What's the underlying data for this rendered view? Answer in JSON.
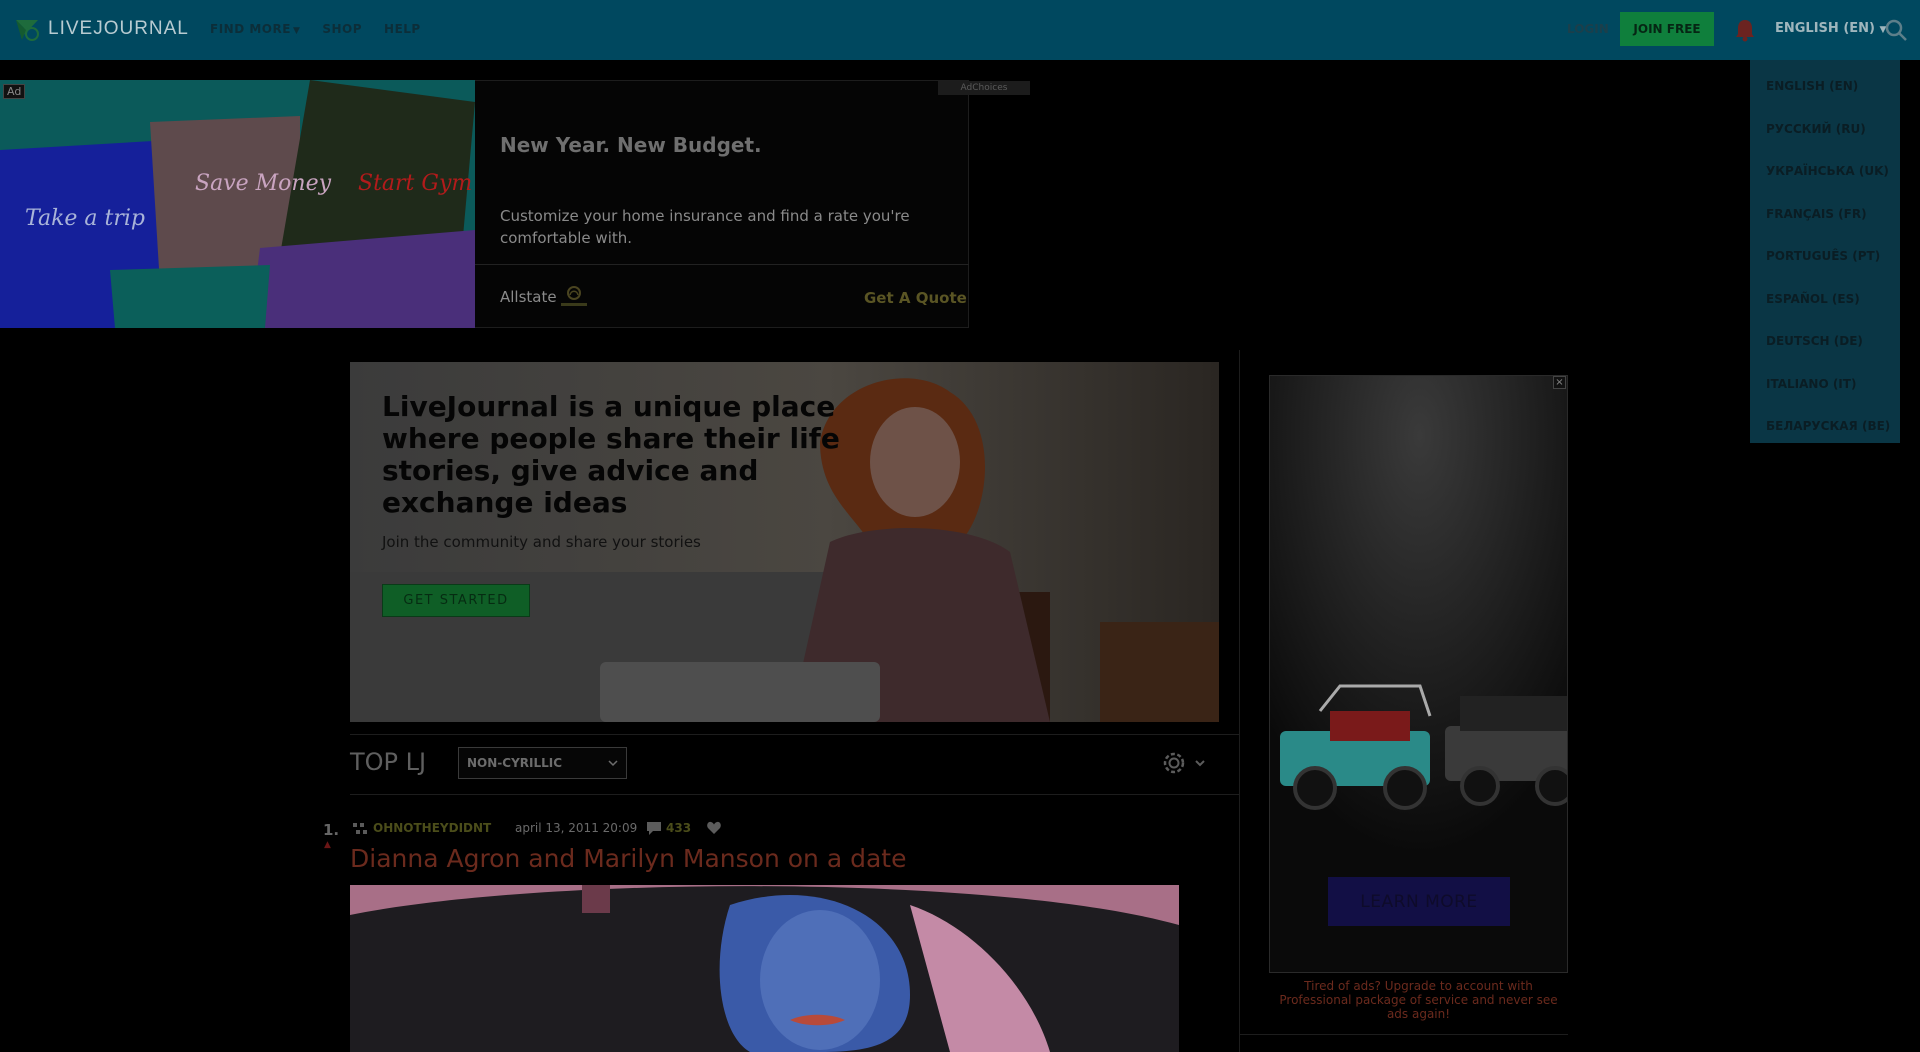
{
  "header": {
    "logo_text": "LIVEJOURNAL",
    "nav": [
      "FIND MORE",
      "SHOP",
      "HELP"
    ],
    "login": "LOGIN",
    "join": "JOIN FREE",
    "language": "ENGLISH (EN)"
  },
  "languages": [
    "ENGLISH (EN)",
    "РУССКИЙ (RU)",
    "УКРАЇНСЬКА (UK)",
    "FRANÇAIS (FR)",
    "PORTUGUÊS (PT)",
    "ESPAÑOL (ES)",
    "DEUTSCH (DE)",
    "ITALIANO (IT)",
    "БЕЛАРУСКАЯ (BE)"
  ],
  "ad_top": {
    "badge": "Ad",
    "image_notes": [
      "Take a trip",
      "Save Money",
      "Start Gym"
    ],
    "headline": "New Year. New Budget.",
    "description": "Customize your home insurance and find a rate you're comfortable with.",
    "brand": "Allstate",
    "cta": "Get A Quote",
    "choices": "AdChoices"
  },
  "hero": {
    "title": "LiveJournal is a unique place where people share their life stories, give advice and exchange ideas",
    "subtitle": "Join the community and share your stories",
    "button": "GET STARTED"
  },
  "top_lj": {
    "title": "TOP LJ",
    "filter": "NON-CYRILLIC"
  },
  "post": {
    "rank": "1.",
    "journal": "OHNOTHEYDIDNT",
    "date": "april 13, 2011 20:09",
    "comments": "433",
    "title": "Dianna Agron and Marilyn Manson on a date"
  },
  "ad_right": {
    "button": "LEARN MORE",
    "note": "Tired of ads? Upgrade to account with Professional package of service and never see ads again!"
  },
  "colors": {
    "header": "#00485f",
    "join": "#0f7f3c",
    "accent_link": "#6b2a1d"
  }
}
